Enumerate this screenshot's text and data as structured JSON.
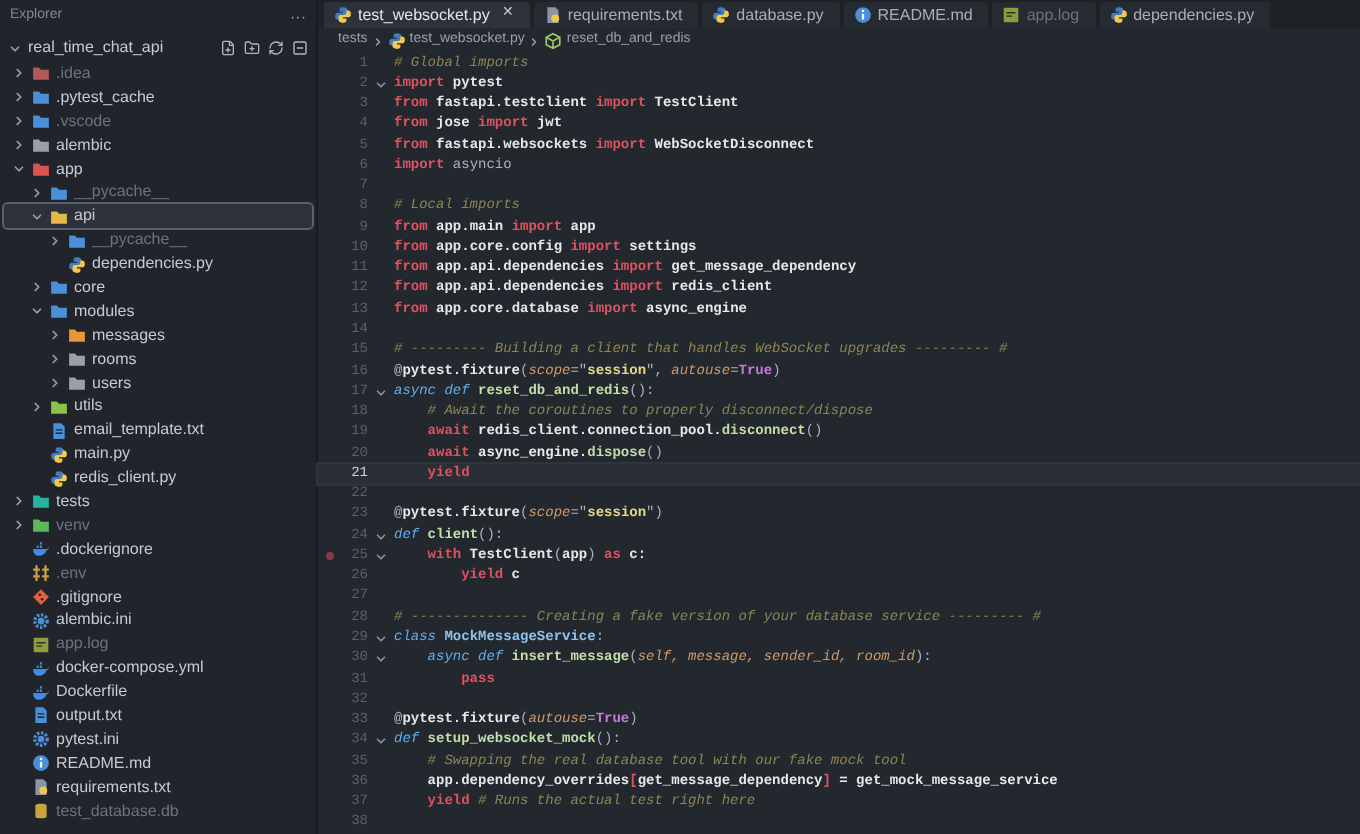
{
  "explorer": {
    "title": "Explorer",
    "more": "···",
    "root": {
      "name": "real_time_chat_api",
      "expanded": true,
      "children": [
        {
          "name": ".idea",
          "kind": "folder",
          "color": "#b05a5a",
          "expanded": false,
          "dimmed": true,
          "selected": false
        },
        {
          "name": ".pytest_cache",
          "kind": "folder",
          "color": "#4a8fd8",
          "expanded": false,
          "dimmed": false,
          "selected": false
        },
        {
          "name": ".vscode",
          "kind": "folder",
          "color": "#4a8fd8",
          "expanded": false,
          "dimmed": true,
          "selected": false
        },
        {
          "name": "alembic",
          "kind": "folder",
          "color": "#9aa0a8",
          "expanded": false,
          "dimmed": false,
          "selected": false
        },
        {
          "name": "app",
          "kind": "folder",
          "color": "#d9534f",
          "expanded": true,
          "dimmed": false,
          "selected": false,
          "children": [
            {
              "name": "__pycache__",
              "kind": "folder",
              "color": "#4a8fd8",
              "expanded": false,
              "dimmed": true,
              "selected": false
            },
            {
              "name": "api",
              "kind": "folder",
              "color": "#e5b84a",
              "expanded": true,
              "dimmed": false,
              "selected": true,
              "children": [
                {
                  "name": "__pycache__",
                  "kind": "folder",
                  "color": "#4a8fd8",
                  "expanded": false,
                  "dimmed": true,
                  "selected": false
                },
                {
                  "name": "dependencies.py",
                  "kind": "python",
                  "dimmed": false,
                  "selected": false
                }
              ]
            },
            {
              "name": "core",
              "kind": "folder",
              "color": "#4a8fd8",
              "expanded": false,
              "dimmed": false,
              "selected": false
            },
            {
              "name": "modules",
              "kind": "folder",
              "color": "#4a8fd8",
              "expanded": true,
              "dimmed": false,
              "selected": false,
              "children": [
                {
                  "name": "messages",
                  "kind": "folder",
                  "color": "#e8943a",
                  "expanded": false,
                  "dimmed": false,
                  "selected": false
                },
                {
                  "name": "rooms",
                  "kind": "folder",
                  "color": "#9aa0a8",
                  "expanded": false,
                  "dimmed": false,
                  "selected": false
                },
                {
                  "name": "users",
                  "kind": "folder",
                  "color": "#9aa0a8",
                  "expanded": false,
                  "dimmed": false,
                  "selected": false
                }
              ]
            },
            {
              "name": "utils",
              "kind": "folder",
              "color": "#8bc34a",
              "expanded": false,
              "dimmed": false,
              "selected": false
            },
            {
              "name": "email_template.txt",
              "kind": "text",
              "dimmed": false,
              "selected": false
            },
            {
              "name": "main.py",
              "kind": "python",
              "dimmed": false,
              "selected": false
            },
            {
              "name": "redis_client.py",
              "kind": "python",
              "dimmed": false,
              "selected": false
            }
          ]
        },
        {
          "name": "tests",
          "kind": "folder",
          "color": "#26b3a3",
          "expanded": false,
          "dimmed": false,
          "selected": false
        },
        {
          "name": "venv",
          "kind": "folder",
          "color": "#5cb85c",
          "expanded": false,
          "dimmed": true,
          "selected": false
        },
        {
          "name": ".dockerignore",
          "kind": "docker",
          "dimmed": false,
          "selected": false
        },
        {
          "name": ".env",
          "kind": "env",
          "dimmed": true,
          "selected": false
        },
        {
          "name": ".gitignore",
          "kind": "git",
          "dimmed": false,
          "selected": false
        },
        {
          "name": "alembic.ini",
          "kind": "config",
          "dimmed": false,
          "selected": false
        },
        {
          "name": "app.log",
          "kind": "log",
          "dimmed": true,
          "selected": false
        },
        {
          "name": "docker-compose.yml",
          "kind": "docker",
          "dimmed": false,
          "selected": false
        },
        {
          "name": "Dockerfile",
          "kind": "docker",
          "dimmed": false,
          "selected": false
        },
        {
          "name": "output.txt",
          "kind": "text",
          "dimmed": false,
          "selected": false
        },
        {
          "name": "pytest.ini",
          "kind": "config",
          "dimmed": false,
          "selected": false
        },
        {
          "name": "README.md",
          "kind": "info",
          "dimmed": false,
          "selected": false
        },
        {
          "name": "requirements.txt",
          "kind": "requirements",
          "dimmed": false,
          "selected": false
        },
        {
          "name": "test_database.db",
          "kind": "db",
          "dimmed": true,
          "selected": false
        }
      ]
    }
  },
  "tabs": [
    {
      "label": "test_websocket.py",
      "kind": "python",
      "selected": true,
      "dimmed": false,
      "close": "✕"
    },
    {
      "label": "requirements.txt",
      "kind": "requirements",
      "selected": false,
      "dimmed": false
    },
    {
      "label": "database.py",
      "kind": "python",
      "selected": false,
      "dimmed": false
    },
    {
      "label": "README.md",
      "kind": "info",
      "selected": false,
      "dimmed": false
    },
    {
      "label": "app.log",
      "kind": "log",
      "selected": false,
      "dimmed": true
    },
    {
      "label": "dependencies.py",
      "kind": "python",
      "selected": false,
      "dimmed": false
    }
  ],
  "breadcrumb": [
    {
      "text": "tests",
      "kind": "folder"
    },
    {
      "text": "test_websocket.py",
      "kind": "python"
    },
    {
      "text": "reset_db_and_redis",
      "kind": "function"
    }
  ],
  "code": [
    {
      "number": "1",
      "tokens": [
        {
          "kind": "cm",
          "text": "# Global imports"
        }
      ]
    },
    {
      "number": "2",
      "expanded": true,
      "tokens": [
        {
          "kind": "kw",
          "text": "import"
        },
        {
          "kind": "plain",
          "text": " pytest"
        }
      ]
    },
    {
      "number": "3",
      "tokens": [
        {
          "kind": "kw",
          "text": "from"
        },
        {
          "kind": "plain",
          "text": " fastapi.testclient "
        },
        {
          "kind": "kw",
          "text": "import"
        },
        {
          "kind": "plain",
          "text": " TestClient"
        }
      ]
    },
    {
      "number": "4",
      "tokens": [
        {
          "kind": "kw",
          "text": "from"
        },
        {
          "kind": "plain",
          "text": " jose "
        },
        {
          "kind": "kw",
          "text": "import"
        },
        {
          "kind": "plain",
          "text": " jwt"
        }
      ]
    },
    {
      "number": "5",
      "tokens": [
        {
          "kind": "kw",
          "text": "from"
        },
        {
          "kind": "plain",
          "text": " fastapi.websockets "
        },
        {
          "kind": "kw",
          "text": "import"
        },
        {
          "kind": "plain",
          "text": " WebSocketDisconnect"
        }
      ]
    },
    {
      "number": "6",
      "tokens": [
        {
          "kind": "kw",
          "text": "import"
        },
        {
          "kind": "op",
          "text": " asyncio"
        }
      ]
    },
    {
      "number": "7"
    },
    {
      "number": "8",
      "tokens": [
        {
          "kind": "cm",
          "text": "# Local imports"
        }
      ]
    },
    {
      "number": "9",
      "tokens": [
        {
          "kind": "kw",
          "text": "from"
        },
        {
          "kind": "plain",
          "text": " app.main "
        },
        {
          "kind": "kw",
          "text": "import"
        },
        {
          "kind": "plain",
          "text": " app"
        }
      ]
    },
    {
      "number": "10",
      "tokens": [
        {
          "kind": "kw",
          "text": "from"
        },
        {
          "kind": "plain",
          "text": " app.core.config "
        },
        {
          "kind": "kw",
          "text": "import"
        },
        {
          "kind": "plain",
          "text": " settings"
        }
      ]
    },
    {
      "number": "11",
      "tokens": [
        {
          "kind": "kw",
          "text": "from"
        },
        {
          "kind": "plain",
          "text": " app.api.dependencies "
        },
        {
          "kind": "kw",
          "text": "import"
        },
        {
          "kind": "plain",
          "text": " get_message_dependency"
        }
      ]
    },
    {
      "number": "12",
      "tokens": [
        {
          "kind": "kw",
          "text": "from"
        },
        {
          "kind": "plain",
          "text": " app.api.dependencies "
        },
        {
          "kind": "kw",
          "text": "import"
        },
        {
          "kind": "plain",
          "text": " redis_client"
        }
      ]
    },
    {
      "number": "13",
      "tokens": [
        {
          "kind": "kw",
          "text": "from"
        },
        {
          "kind": "plain",
          "text": " app.core.database "
        },
        {
          "kind": "kw",
          "text": "import"
        },
        {
          "kind": "plain",
          "text": " async_engine"
        }
      ]
    },
    {
      "number": "14"
    },
    {
      "number": "15",
      "tokens": [
        {
          "kind": "cm",
          "text": "# --------- Building a client that handles WebSocket upgrades --------- #"
        }
      ]
    },
    {
      "number": "16",
      "tokens": [
        {
          "kind": "op",
          "text": "@"
        },
        {
          "kind": "plain",
          "text": "pytest.fixture"
        },
        {
          "kind": "op",
          "text": "("
        },
        {
          "kind": "param",
          "text": "scope"
        },
        {
          "kind": "op",
          "text": "=\""
        },
        {
          "kind": "str",
          "text": "session"
        },
        {
          "kind": "op",
          "text": "\", "
        },
        {
          "kind": "param",
          "text": "autouse"
        },
        {
          "kind": "op",
          "text": "="
        },
        {
          "kind": "const",
          "text": "True"
        },
        {
          "kind": "op",
          "text": ")"
        }
      ]
    },
    {
      "number": "17",
      "expanded": true,
      "tokens": [
        {
          "kind": "def",
          "text": "async def"
        },
        {
          "kind": "fn",
          "text": " reset_db_and_redis"
        },
        {
          "kind": "op",
          "text": "():"
        }
      ]
    },
    {
      "number": "18",
      "tokens": [
        {
          "kind": "cm",
          "text": "    # Await the coroutines to properly disconnect/dispose"
        }
      ]
    },
    {
      "number": "19",
      "tokens": [
        {
          "kind": "kw",
          "text": "    await"
        },
        {
          "kind": "plain",
          "text": " redis_client.connection_pool."
        },
        {
          "kind": "fn",
          "text": "disconnect"
        },
        {
          "kind": "op",
          "text": "()"
        }
      ]
    },
    {
      "number": "20",
      "tokens": [
        {
          "kind": "kw",
          "text": "    await"
        },
        {
          "kind": "plain",
          "text": " async_engine."
        },
        {
          "kind": "fn",
          "text": "dispose"
        },
        {
          "kind": "op",
          "text": "()"
        }
      ]
    },
    {
      "number": "21",
      "current": true,
      "tokens": [
        {
          "kind": "kw",
          "text": "    yield"
        }
      ]
    },
    {
      "number": "22"
    },
    {
      "number": "23",
      "tokens": [
        {
          "kind": "op",
          "text": "@"
        },
        {
          "kind": "plain",
          "text": "pytest.fixture"
        },
        {
          "kind": "op",
          "text": "("
        },
        {
          "kind": "param",
          "text": "scope"
        },
        {
          "kind": "op",
          "text": "=\""
        },
        {
          "kind": "str",
          "text": "session"
        },
        {
          "kind": "op",
          "text": "\")"
        }
      ]
    },
    {
      "number": "24",
      "expanded": true,
      "tokens": [
        {
          "kind": "def",
          "text": "def"
        },
        {
          "kind": "fn",
          "text": " client"
        },
        {
          "kind": "op",
          "text": "():"
        }
      ]
    },
    {
      "number": "25",
      "expanded": true,
      "breakpoint": true,
      "tokens": [
        {
          "kind": "kw",
          "text": "    with"
        },
        {
          "kind": "plain",
          "text": " TestClient"
        },
        {
          "kind": "op",
          "text": "("
        },
        {
          "kind": "plain",
          "text": "app"
        },
        {
          "kind": "op",
          "text": ")"
        },
        {
          "kind": "kw",
          "text": " as"
        },
        {
          "kind": "plain",
          "text": " c:"
        }
      ]
    },
    {
      "number": "26",
      "tokens": [
        {
          "kind": "kw",
          "text": "        yield"
        },
        {
          "kind": "plain",
          "text": " c"
        }
      ]
    },
    {
      "number": "27"
    },
    {
      "number": "28",
      "tokens": [
        {
          "kind": "cm",
          "text": "# -------------- Creating a fake version of your database service --------- #"
        }
      ]
    },
    {
      "number": "29",
      "expanded": true,
      "tokens": [
        {
          "kind": "def",
          "text": "class"
        },
        {
          "kind": "cls",
          "text": " MockMessageService"
        },
        {
          "kind": "op",
          "text": ":"
        }
      ]
    },
    {
      "number": "30",
      "expanded": true,
      "tokens": [
        {
          "kind": "def",
          "text": "    async def"
        },
        {
          "kind": "fn",
          "text": " insert_message"
        },
        {
          "kind": "op",
          "text": "("
        },
        {
          "kind": "param",
          "text": "self, message, sender_id, room_id"
        },
        {
          "kind": "op",
          "text": "):"
        }
      ]
    },
    {
      "number": "31",
      "tokens": [
        {
          "kind": "kw",
          "text": "        pass"
        }
      ]
    },
    {
      "number": "32"
    },
    {
      "number": "33",
      "tokens": [
        {
          "kind": "op",
          "text": "@"
        },
        {
          "kind": "plain",
          "text": "pytest.fixture"
        },
        {
          "kind": "op",
          "text": "("
        },
        {
          "kind": "param",
          "text": "autouse"
        },
        {
          "kind": "op",
          "text": "="
        },
        {
          "kind": "const",
          "text": "True"
        },
        {
          "kind": "op",
          "text": ")"
        }
      ]
    },
    {
      "number": "34",
      "expanded": true,
      "tokens": [
        {
          "kind": "def",
          "text": "def"
        },
        {
          "kind": "fn",
          "text": " setup_websocket_mock"
        },
        {
          "kind": "op",
          "text": "():"
        }
      ]
    },
    {
      "number": "35",
      "tokens": [
        {
          "kind": "cm",
          "text": "    # Swapping the real database tool with our fake mock tool"
        }
      ]
    },
    {
      "number": "36",
      "tokens": [
        {
          "kind": "plain",
          "text": "    app.dependency_overrides"
        },
        {
          "kind": "kw",
          "text": "["
        },
        {
          "kind": "plain",
          "text": "get_message_dependency"
        },
        {
          "kind": "kw",
          "text": "]"
        },
        {
          "kind": "plain",
          "text": " = get_mock_message_service"
        }
      ]
    },
    {
      "number": "37",
      "tokens": [
        {
          "kind": "kw",
          "text": "    yield"
        },
        {
          "kind": "cm",
          "text": " # Runs the actual test right here"
        }
      ]
    },
    {
      "number": "38"
    }
  ]
}
